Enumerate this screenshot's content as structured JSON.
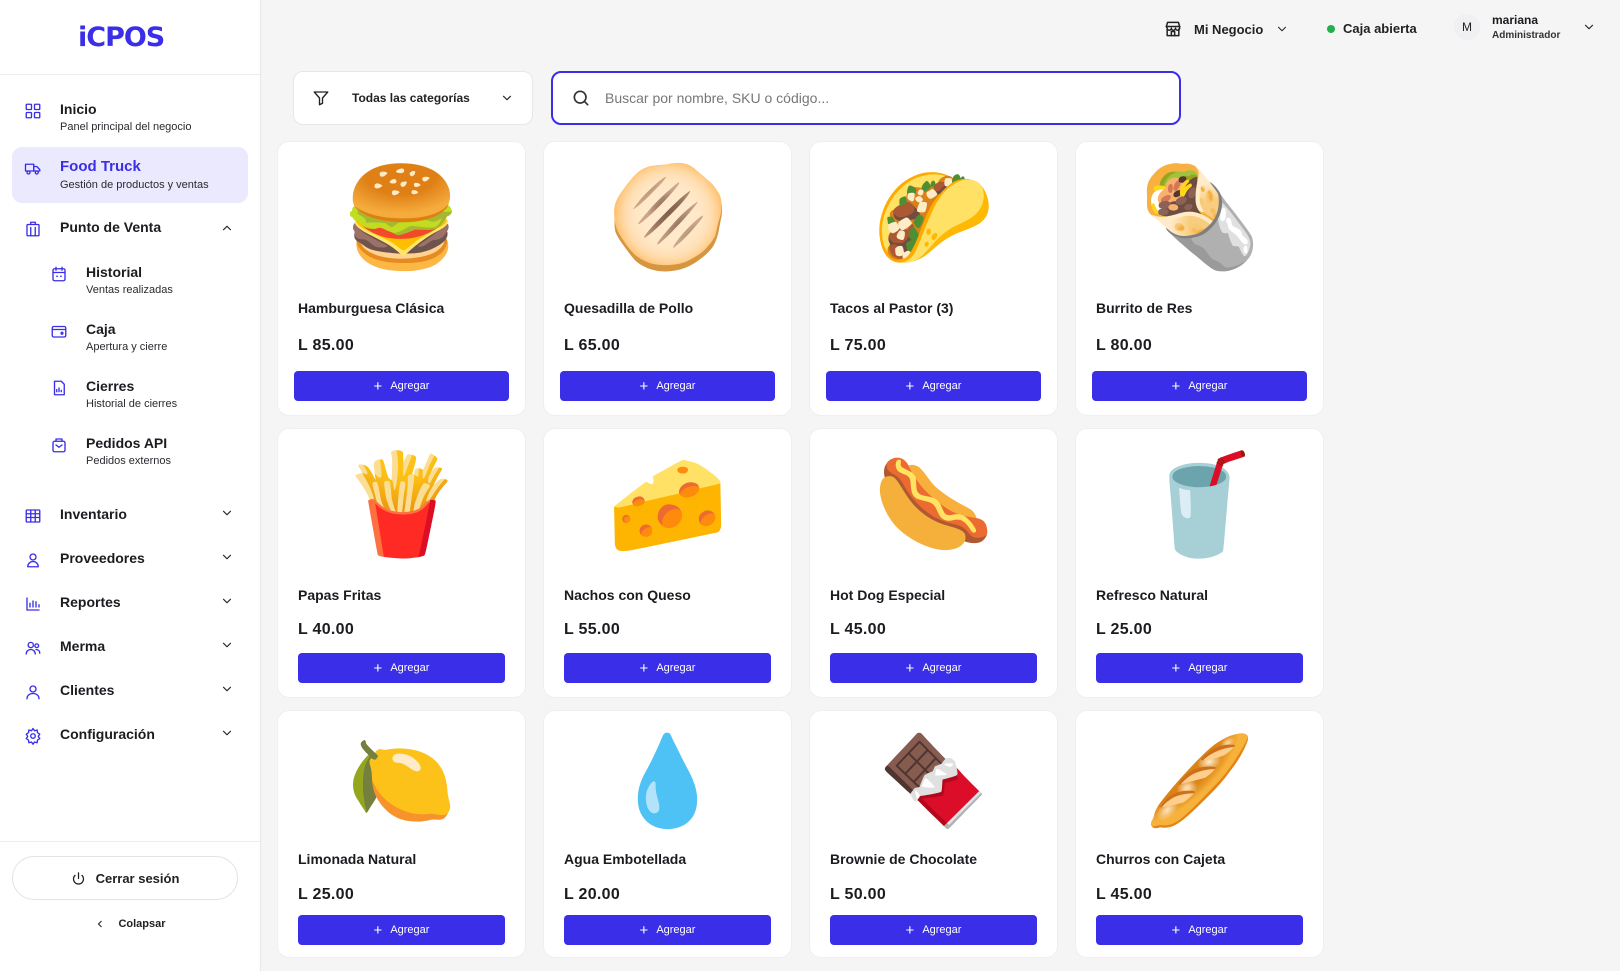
{
  "app": {
    "logo": "iCPOS"
  },
  "header": {
    "business": "Mi Negocio",
    "register_status": "Caja abierta",
    "user": {
      "initial": "M",
      "name": "mariana",
      "role": "Administrador"
    }
  },
  "sidebar": {
    "items": [
      {
        "title": "Inicio",
        "subtitle": "Panel principal del negocio",
        "icon": "grid-icon"
      },
      {
        "title": "Food Truck",
        "subtitle": "Gestión de productos y ventas",
        "icon": "truck-icon",
        "active": true
      },
      {
        "title": "Punto de Venta",
        "icon": "store-icon",
        "expanded": true
      }
    ],
    "pos_items": [
      {
        "title": "Historial",
        "subtitle": "Ventas realizadas",
        "icon": "calendar-icon"
      },
      {
        "title": "Caja",
        "subtitle": "Apertura y cierre",
        "icon": "wallet-icon"
      },
      {
        "title": "Cierres",
        "subtitle": "Historial de cierres",
        "icon": "report-icon"
      },
      {
        "title": "Pedidos API",
        "subtitle": "Pedidos externos",
        "icon": "package-icon"
      }
    ],
    "sections": [
      {
        "title": "Inventario",
        "icon": "table-icon"
      },
      {
        "title": "Proveedores",
        "icon": "supplier-icon"
      },
      {
        "title": "Reportes",
        "icon": "bar-chart-icon"
      },
      {
        "title": "Merma",
        "icon": "users-icon"
      },
      {
        "title": "Clientes",
        "icon": "user-icon"
      },
      {
        "title": "Configuración",
        "icon": "gear-icon"
      }
    ],
    "logout_label": "Cerrar sesión",
    "collapse_label": "Colapsar"
  },
  "filters": {
    "category": "Todas las categorías",
    "search_placeholder": "Buscar por nombre, SKU o código..."
  },
  "add_label": "Agregar",
  "products": [
    {
      "name": "Hamburguesa Clásica",
      "price": "L 85.00",
      "emoji": "🍔"
    },
    {
      "name": "Quesadilla de Pollo",
      "price": "L 65.00",
      "emoji": "🫓"
    },
    {
      "name": "Tacos al Pastor (3)",
      "price": "L 75.00",
      "emoji": "🌮"
    },
    {
      "name": "Burrito de Res",
      "price": "L 80.00",
      "emoji": "🌯"
    },
    {
      "name": "Papas Fritas",
      "price": "L 40.00",
      "emoji": "🍟"
    },
    {
      "name": "Nachos con Queso",
      "price": "L 55.00",
      "emoji": "🧀"
    },
    {
      "name": "Hot Dog Especial",
      "price": "L 45.00",
      "emoji": "🌭"
    },
    {
      "name": "Refresco Natural",
      "price": "L 25.00",
      "emoji": "🥤"
    },
    {
      "name": "Limonada Natural",
      "price": "L 25.00",
      "emoji": "🍋"
    },
    {
      "name": "Agua Embotellada",
      "price": "L 20.00",
      "emoji": "💧"
    },
    {
      "name": "Brownie de Chocolate",
      "price": "L 50.00",
      "emoji": "🍫"
    },
    {
      "name": "Churros con Cajeta",
      "price": "L 45.00",
      "emoji": "🥖"
    }
  ]
}
